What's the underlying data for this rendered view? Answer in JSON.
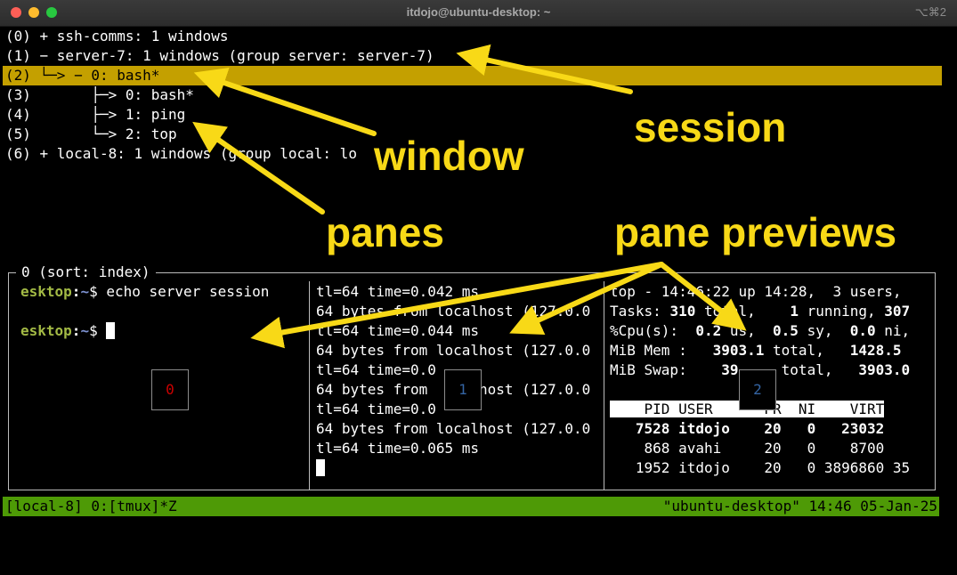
{
  "window": {
    "title": "itdojo@ubuntu-desktop: ~",
    "shortcut": "⌥⌘2"
  },
  "tree": [
    {
      "text": "(0) + ssh-comms: 1 windows",
      "selected": false
    },
    {
      "text": "(1) − server-7: 1 windows (group server: server-7)",
      "selected": false
    },
    {
      "text": "(2) └─> − 0: bash*",
      "selected": true
    },
    {
      "text": "(3)       ├─> 0: bash*",
      "selected": false
    },
    {
      "text": "(4)       ├─> 1: ping",
      "selected": false
    },
    {
      "text": "(5)       └─> 2: top",
      "selected": false
    },
    {
      "text": "(6) + local-8: 1 windows (group local: lo",
      "selected": false
    }
  ],
  "preview": {
    "title": "0 (sort: index)",
    "pane0": {
      "number": "0",
      "number_color": "#cc0000",
      "line1_host": "esktop",
      "line1_path": "~",
      "line1_cmd": "$ echo server session",
      "line3_host": "esktop",
      "line3_path": "~",
      "line3_prompt": "$ "
    },
    "pane1": {
      "number": "1",
      "number_color": "#3465a4",
      "lines": [
        "tl=64 time=0.042 ms",
        "64 bytes from localhost (127.0.0",
        "tl=64 time=0.044 ms",
        "64 bytes from localhost (127.0.0",
        "tl=64 time=0.0",
        "64 bytes from      host (127.0.0",
        "tl=64 time=0.0",
        "64 bytes from localhost (127.0.0",
        "tl=64 time=0.065 ms"
      ]
    },
    "pane2": {
      "number": "2",
      "number_color": "#3465a4",
      "line1": "top - 14:46:22 up 14:28,  3 users,",
      "tasks_label": "Tasks: ",
      "tasks_total": "310",
      "tasks_total_label": " total,    ",
      "tasks_running": "1",
      "tasks_running_label": " running, ",
      "tasks_sleeping": "307",
      "cpu_label": "%Cpu(s):  ",
      "cpu_us": "0.2",
      "cpu_us_label": " us,  ",
      "cpu_sy": "0.5",
      "cpu_sy_label": " sy,  ",
      "cpu_ni": "0.0",
      "cpu_ni_label": " ni,",
      "mem_label": "MiB Mem :   ",
      "mem_total": "3903.1",
      "mem_total_label": " total,   ",
      "mem_free": "1428.5",
      "swap_label": "MiB Swap:    ",
      "swap_total": "39",
      "swap_total_label": "     total,   ",
      "swap_free": "3903.0",
      "header": "    PID USER      PR  NI    VIRT",
      "rows": [
        {
          "pid": "   7528",
          "user": " itdojo",
          "rest": "    20   0   23032"
        },
        {
          "pid": "    868",
          "user": " avahi ",
          "rest": "    20   0    8700"
        },
        {
          "pid": "   1952",
          "user": " itdojo",
          "rest": "    20   0 3896860 35"
        }
      ]
    }
  },
  "status_bar": {
    "left": "[local-8] 0:[tmux]*Z",
    "right": "\"ubuntu-desktop\" 14:46 05-Jan-25",
    "color": "#4e9a06"
  },
  "annotations": {
    "session": "session",
    "window": "window",
    "panes": "panes",
    "pane_previews": "pane previews",
    "color": "#f8d917"
  }
}
